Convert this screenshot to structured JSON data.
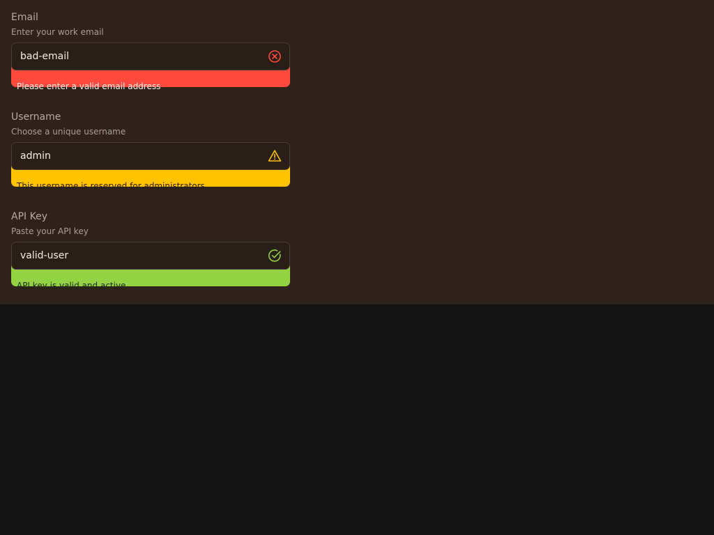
{
  "form": {
    "fields": [
      {
        "label": "Email",
        "hint": "Enter your work email",
        "value": "bad-email",
        "status": "error",
        "status_icon": "x-circle-icon",
        "message": "Please enter a valid email address"
      },
      {
        "label": "Username",
        "hint": "Choose a unique username",
        "value": "admin",
        "status": "warning",
        "status_icon": "warning-triangle-icon",
        "message": "This username is reserved for administrators"
      },
      {
        "label": "API Key",
        "hint": "Paste your API key",
        "value": "valid-user",
        "status": "success",
        "status_icon": "check-circle-icon",
        "message": "API key is valid and active"
      }
    ]
  },
  "colors": {
    "panel_background": "#2e221a",
    "page_background": "#131313",
    "error": "#ff4a3d",
    "warning": "#ffc300",
    "success": "#92d243"
  }
}
